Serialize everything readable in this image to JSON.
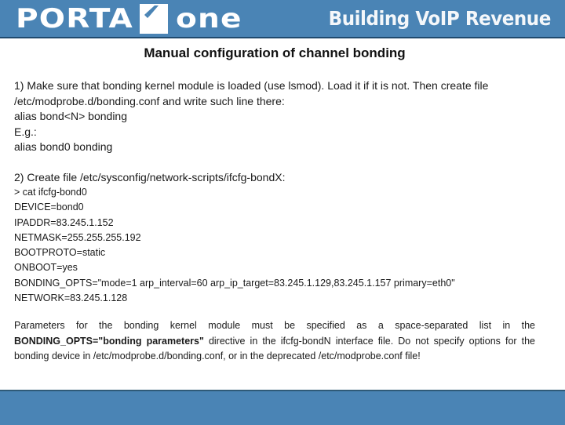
{
  "header": {
    "logo_left": "PORTA",
    "logo_right": "one",
    "logo_icon": "portaone-checkmark-icon",
    "tagline": "Building VoIP Revenue",
    "brand_color": "#4a84b5"
  },
  "slide": {
    "title": "Manual configuration of channel bonding",
    "step1": {
      "line1": "1) Make sure that bonding kernel module is loaded  (use lsmod). Load it if it is not. Then create file",
      "line2": "/etc/modprobe.d/bonding.conf and write such line there:",
      "line3": "alias bond<N> bonding",
      "line4": "E.g.:",
      "line5": "alias bond0 bonding"
    },
    "step2": {
      "heading": "2) Create file /etc/sysconfig/network-scripts/ifcfg-bondX:",
      "code_lines": [
        "> cat ifcfg-bond0",
        "DEVICE=bond0",
        "IPADDR=83.245.1.152",
        "NETMASK=255.255.255.192",
        "BOOTPROTO=static",
        "ONBOOT=yes",
        "BONDING_OPTS=\"mode=1 arp_interval=60 arp_ip_target=83.245.1.129,83.245.1.157 primary=eth0\"",
        "NETWORK=83.245.1.128"
      ]
    },
    "note": {
      "before": "Parameters for the bonding kernel module must be specified as a space-separated list in the ",
      "bold": "BONDING_OPTS=\"bonding parameters\"",
      "after": " directive in the ifcfg-bondN interface file. Do not specify options for the bonding device in /etc/modprobe.d/bonding.conf, or in the deprecated /etc/modprobe.conf file!"
    }
  }
}
